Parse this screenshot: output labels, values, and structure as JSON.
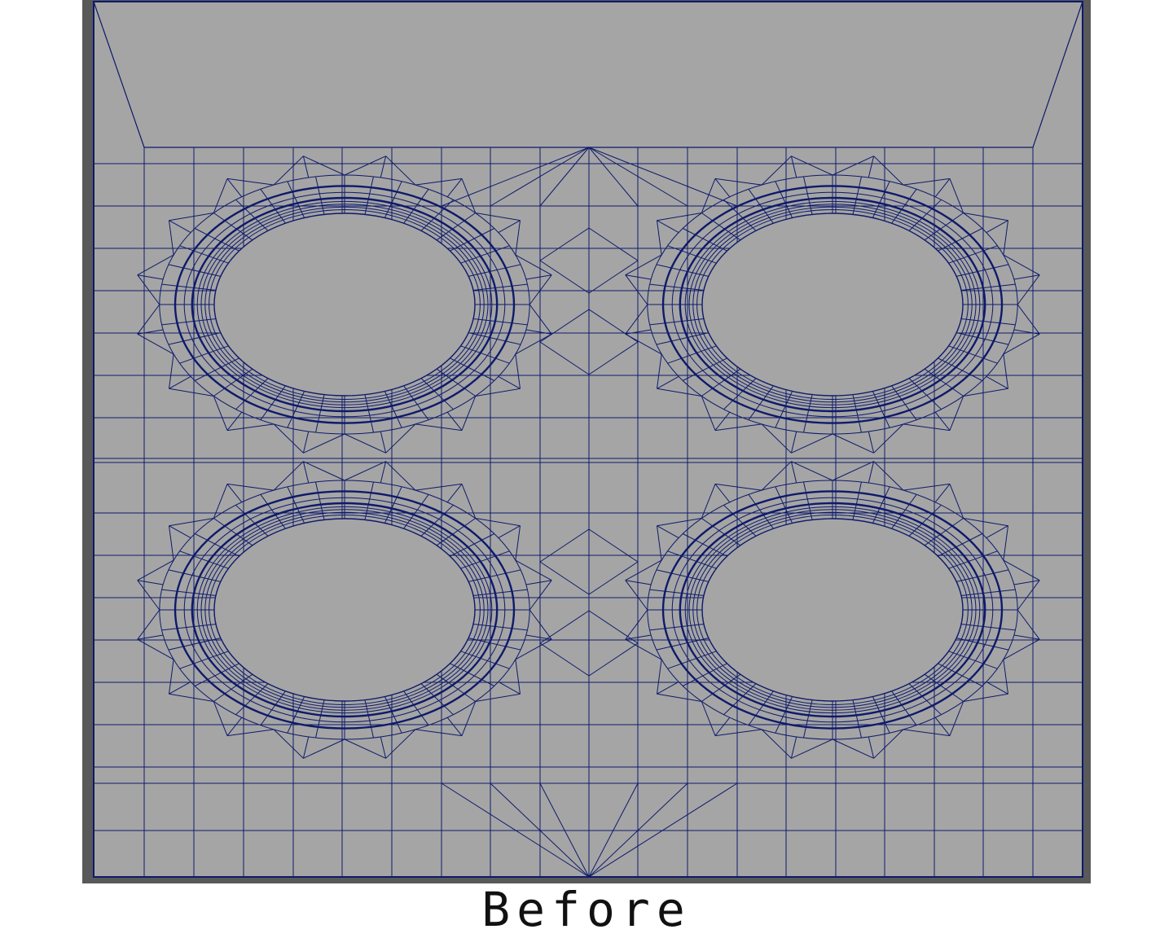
{
  "caption": "Before",
  "colors": {
    "frame": "#595959",
    "surface": "#a5a5a5",
    "wire": "#0e1a6a",
    "background": "#ffffff"
  },
  "mesh": {
    "hole_count": 4,
    "ring_count": 9,
    "spoke_count": 40
  }
}
